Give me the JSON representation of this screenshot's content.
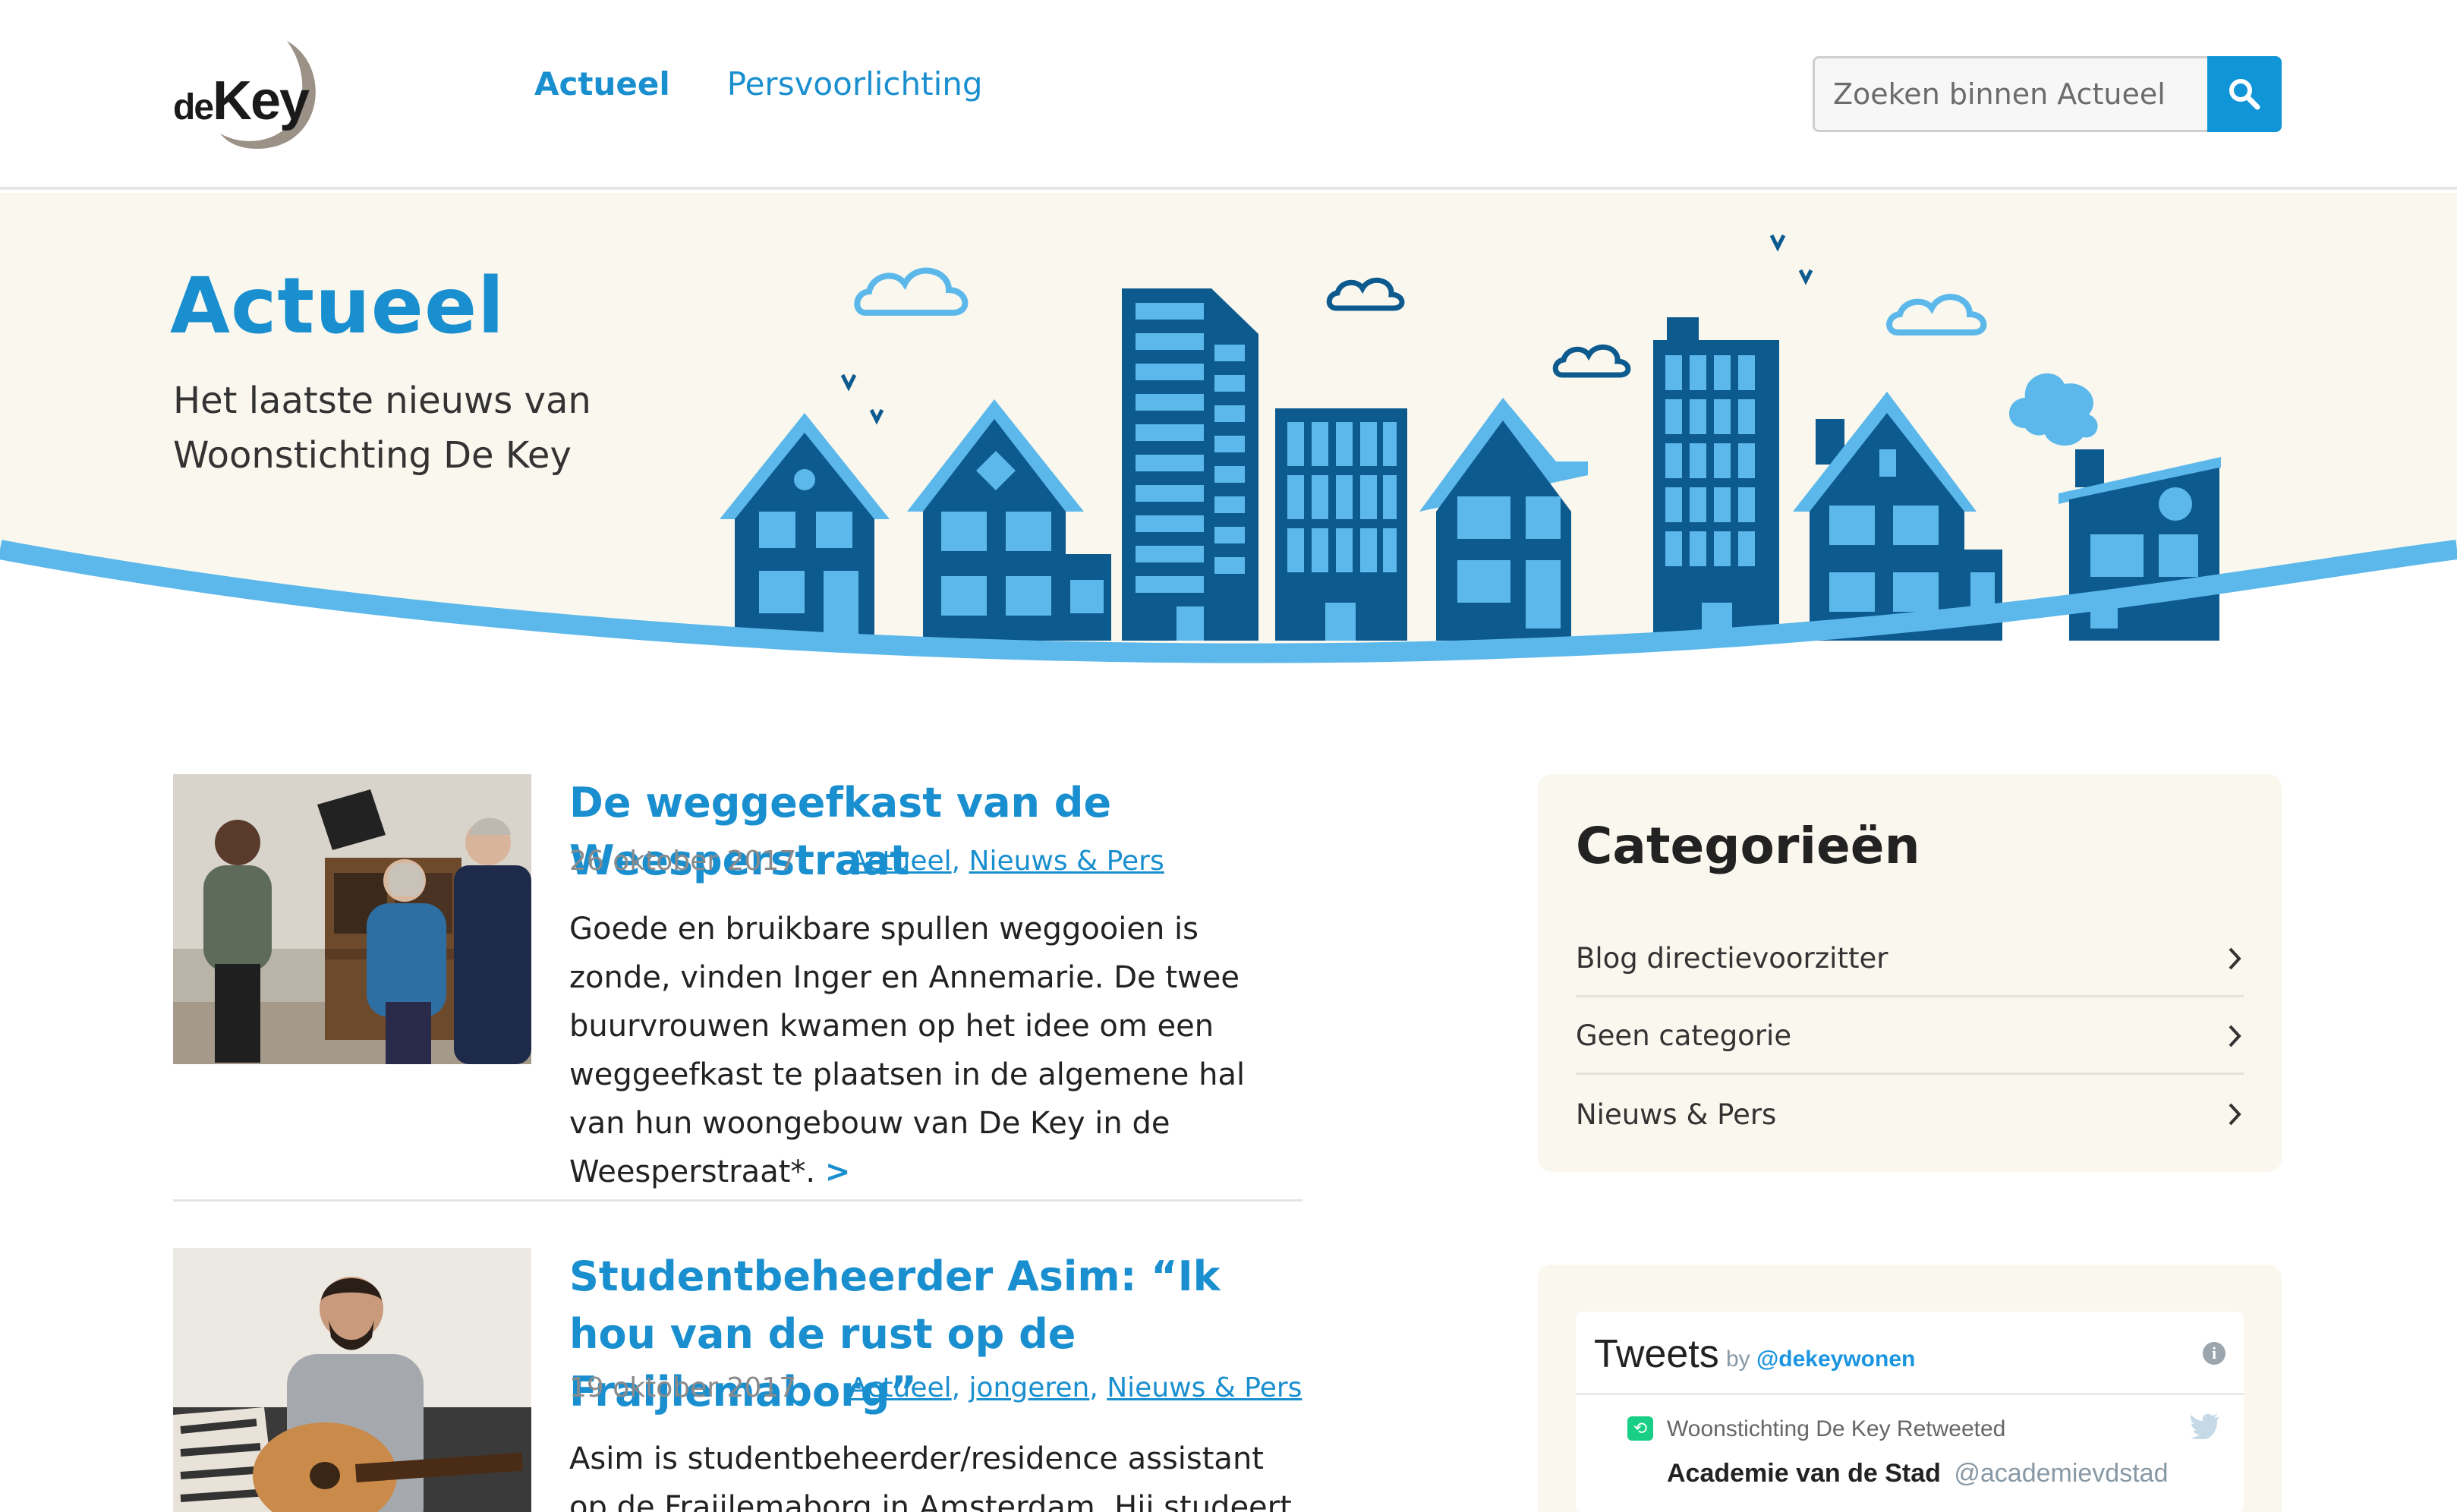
{
  "header": {
    "logo": {
      "small": "de",
      "big": "Key"
    },
    "nav": [
      {
        "label": "Actueel"
      },
      {
        "label": "Persvoorlichting"
      }
    ],
    "search": {
      "placeholder": "Zoeken binnen Actueel"
    }
  },
  "hero": {
    "title": "Actueel",
    "subtitle_line1": "Het laatste nieuws van",
    "subtitle_line2": "Woonstichting De Key"
  },
  "articles": [
    {
      "title": "De weggeefkast van de Weesperstraat",
      "date": "26 oktober 2017",
      "categories": [
        "Actueel",
        "Nieuws & Pers"
      ],
      "excerpt": "Goede en bruikbare spullen weggooien is zonde, vinden Inger en Annemarie. De twee buurvrouwen kwamen op het idee om een weggeefkast te plaatsen in de algemene hal van hun woongebouw van De Key in de Weesperstraat*.",
      "more": ">"
    },
    {
      "title": "Studentbeheerder Asim: “Ik hou van de rust op de Fraijlemaborg”",
      "date": "19 oktober 2017",
      "categories": [
        "Actueel",
        "jongeren",
        "Nieuws & Pers"
      ],
      "excerpt": "Asim is studentbeheerder/residence assistant op de Fraijlemaborg in Amsterdam. Hij studeert sinds drie"
    }
  ],
  "sidebar": {
    "categories_title": "Categorieën",
    "categories": [
      {
        "label": "Blog directievoorzitter"
      },
      {
        "label": "Geen categorie"
      },
      {
        "label": "Nieuws & Pers"
      }
    ],
    "tweets": {
      "title": "Tweets",
      "by": "by",
      "handle": "@dekeywonen",
      "retweet_label": "Woonstichting De Key Retweeted",
      "author_name": "Academie van de Stad",
      "author_handle": "@academievdstad"
    }
  },
  "colors": {
    "brand_blue": "#1a8fcf",
    "building_dark": "#0d5a8f",
    "building_light": "#5cb8ea",
    "hero_bg": "#f9f7ee"
  }
}
